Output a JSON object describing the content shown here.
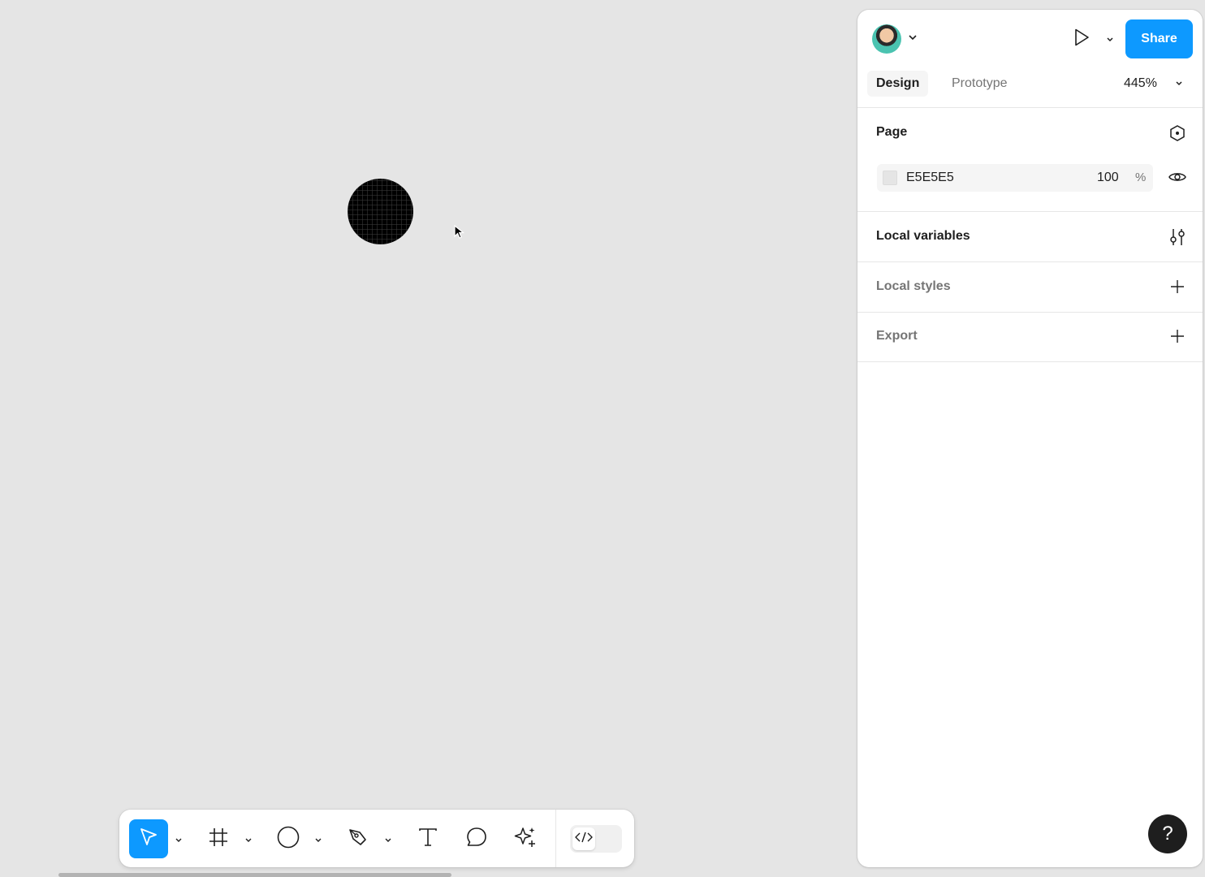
{
  "header": {
    "share_label": "Share"
  },
  "tabs": {
    "design": "Design",
    "prototype": "Prototype"
  },
  "zoom": "445%",
  "page_section": {
    "title": "Page",
    "fill_hex": "E5E5E5",
    "fill_opacity": "100",
    "percent_sign": "%"
  },
  "sections": {
    "local_variables": "Local variables",
    "local_styles": "Local styles",
    "export": "Export"
  },
  "help_label": "?",
  "colors": {
    "accent": "#0d99ff",
    "canvas": "#e5e5e5",
    "panel": "#ffffff"
  },
  "icons": [
    "avatar",
    "chevron-down-icon",
    "play-icon",
    "page-settings-icon",
    "eye-icon",
    "variables-icon",
    "plus-icon",
    "move-tool-icon",
    "frame-tool-icon",
    "ellipse-tool-icon",
    "pen-tool-icon",
    "text-tool-icon",
    "comment-tool-icon",
    "ai-actions-icon",
    "code-icon"
  ]
}
